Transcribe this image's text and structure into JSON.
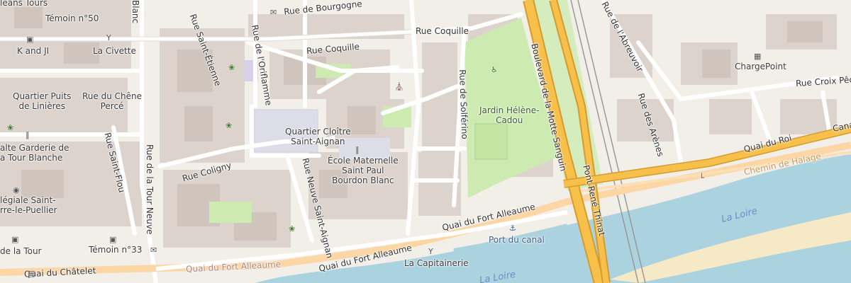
{
  "map": {
    "colors": {
      "land": "#f2efe9",
      "building": "#d9d0c9",
      "water": "#aad3df",
      "park": "#c8facc",
      "primary_road": "#fcd6a4",
      "trunk_road": "#f7c04a",
      "pedestrian": "#dddde8",
      "railway": "#9a9a9a",
      "sand": "#f5e9c6"
    },
    "streets": {
      "rue_de_bourgogne": "Rue de Bourgogne",
      "rue_coquille_1": "Rue Coquille",
      "rue_coquille_2": "Rue Coquille",
      "rue_de_lorifflamme": "Rue de l'Oriflamme",
      "rue_saint_etienne": "Rue Saint-Étienne",
      "rue_de_solferino": "Rue de Solférino",
      "boulevard_motte_sanguin": "Boulevard de la Motte Sanguin",
      "pont_rene_thinat": "Pont René Thinat",
      "rue_abreuvoir": "Rue de l'Abreuvoir",
      "rue_des_arenes": "Rue des Arènes",
      "rue_croix_pech": "Rue Croix Pêch",
      "quai_du_roi": "Quai du Roi",
      "chemin_de_halage": "Chemin de Halage",
      "canal": "Cana",
      "quai_fort_alleaume_1": "Quai du Fort Alleaume",
      "quai_fort_alleaume_2": "Quai du Fort Alleaume",
      "quai_fort_alleaume_3": "Quai du Fort Alleaume",
      "quai_du_chatelet": "Quai du Châtelet",
      "rue_coligny": "Rue Coligny",
      "rue_de_la_tour_neuve": "Rue de la Tour Neuve",
      "rue_neuve_saint_aignan": "Rue Neuve Saint-Aignan",
      "rue_saint_flou": "Rue Saint-Flou",
      "rue_blanc": "Blanc"
    },
    "places": {
      "temoin_50": "Témoin n°50",
      "orleans_tours": "léans Tours",
      "k_and_ji": "K and JI",
      "la_civette": "La Civette",
      "quartier_puits_line1": "Quartier Puits",
      "quartier_puits_line2": "de Linières",
      "rue_chene_line1": "Rue du Chêne",
      "rue_chene_line2": "Percé",
      "halte_garderie_line1": "alte Garderie de",
      "halte_garderie_line2": "a Tour Blanche",
      "collegiale_line1": "légiale Saint-",
      "collegiale_line2": "rre-le-Puellier",
      "de_la_tour": "de la Tour",
      "temoin_33": "Témoin n°33",
      "quartier_cloitre_line1": "Quartier Cloître",
      "quartier_cloitre_line2": "Saint-Aignan",
      "ecole_line1": "École Maternelle",
      "ecole_line2": "Saint Paul",
      "ecole_line3": "Bourdon Blanc",
      "jardin_line1": "Jardin Hélène-",
      "jardin_line2": "Cadou",
      "chargepoint": "ChargePoint",
      "port_du_canal": "Port du canal",
      "la_capitainerie": "La Capitainerie"
    },
    "water": {
      "la_loire_1": "La Loire",
      "la_loire_2": "La Loire"
    },
    "icons": [
      "bank-icon",
      "bar-icon",
      "school-icon",
      "garden-icon",
      "place-of-worship-icon",
      "museum-icon",
      "charging-station-icon",
      "marina-icon",
      "bus-stop-icon",
      "playground-icon",
      "kindergarten-icon",
      "mailbox-icon"
    ]
  }
}
